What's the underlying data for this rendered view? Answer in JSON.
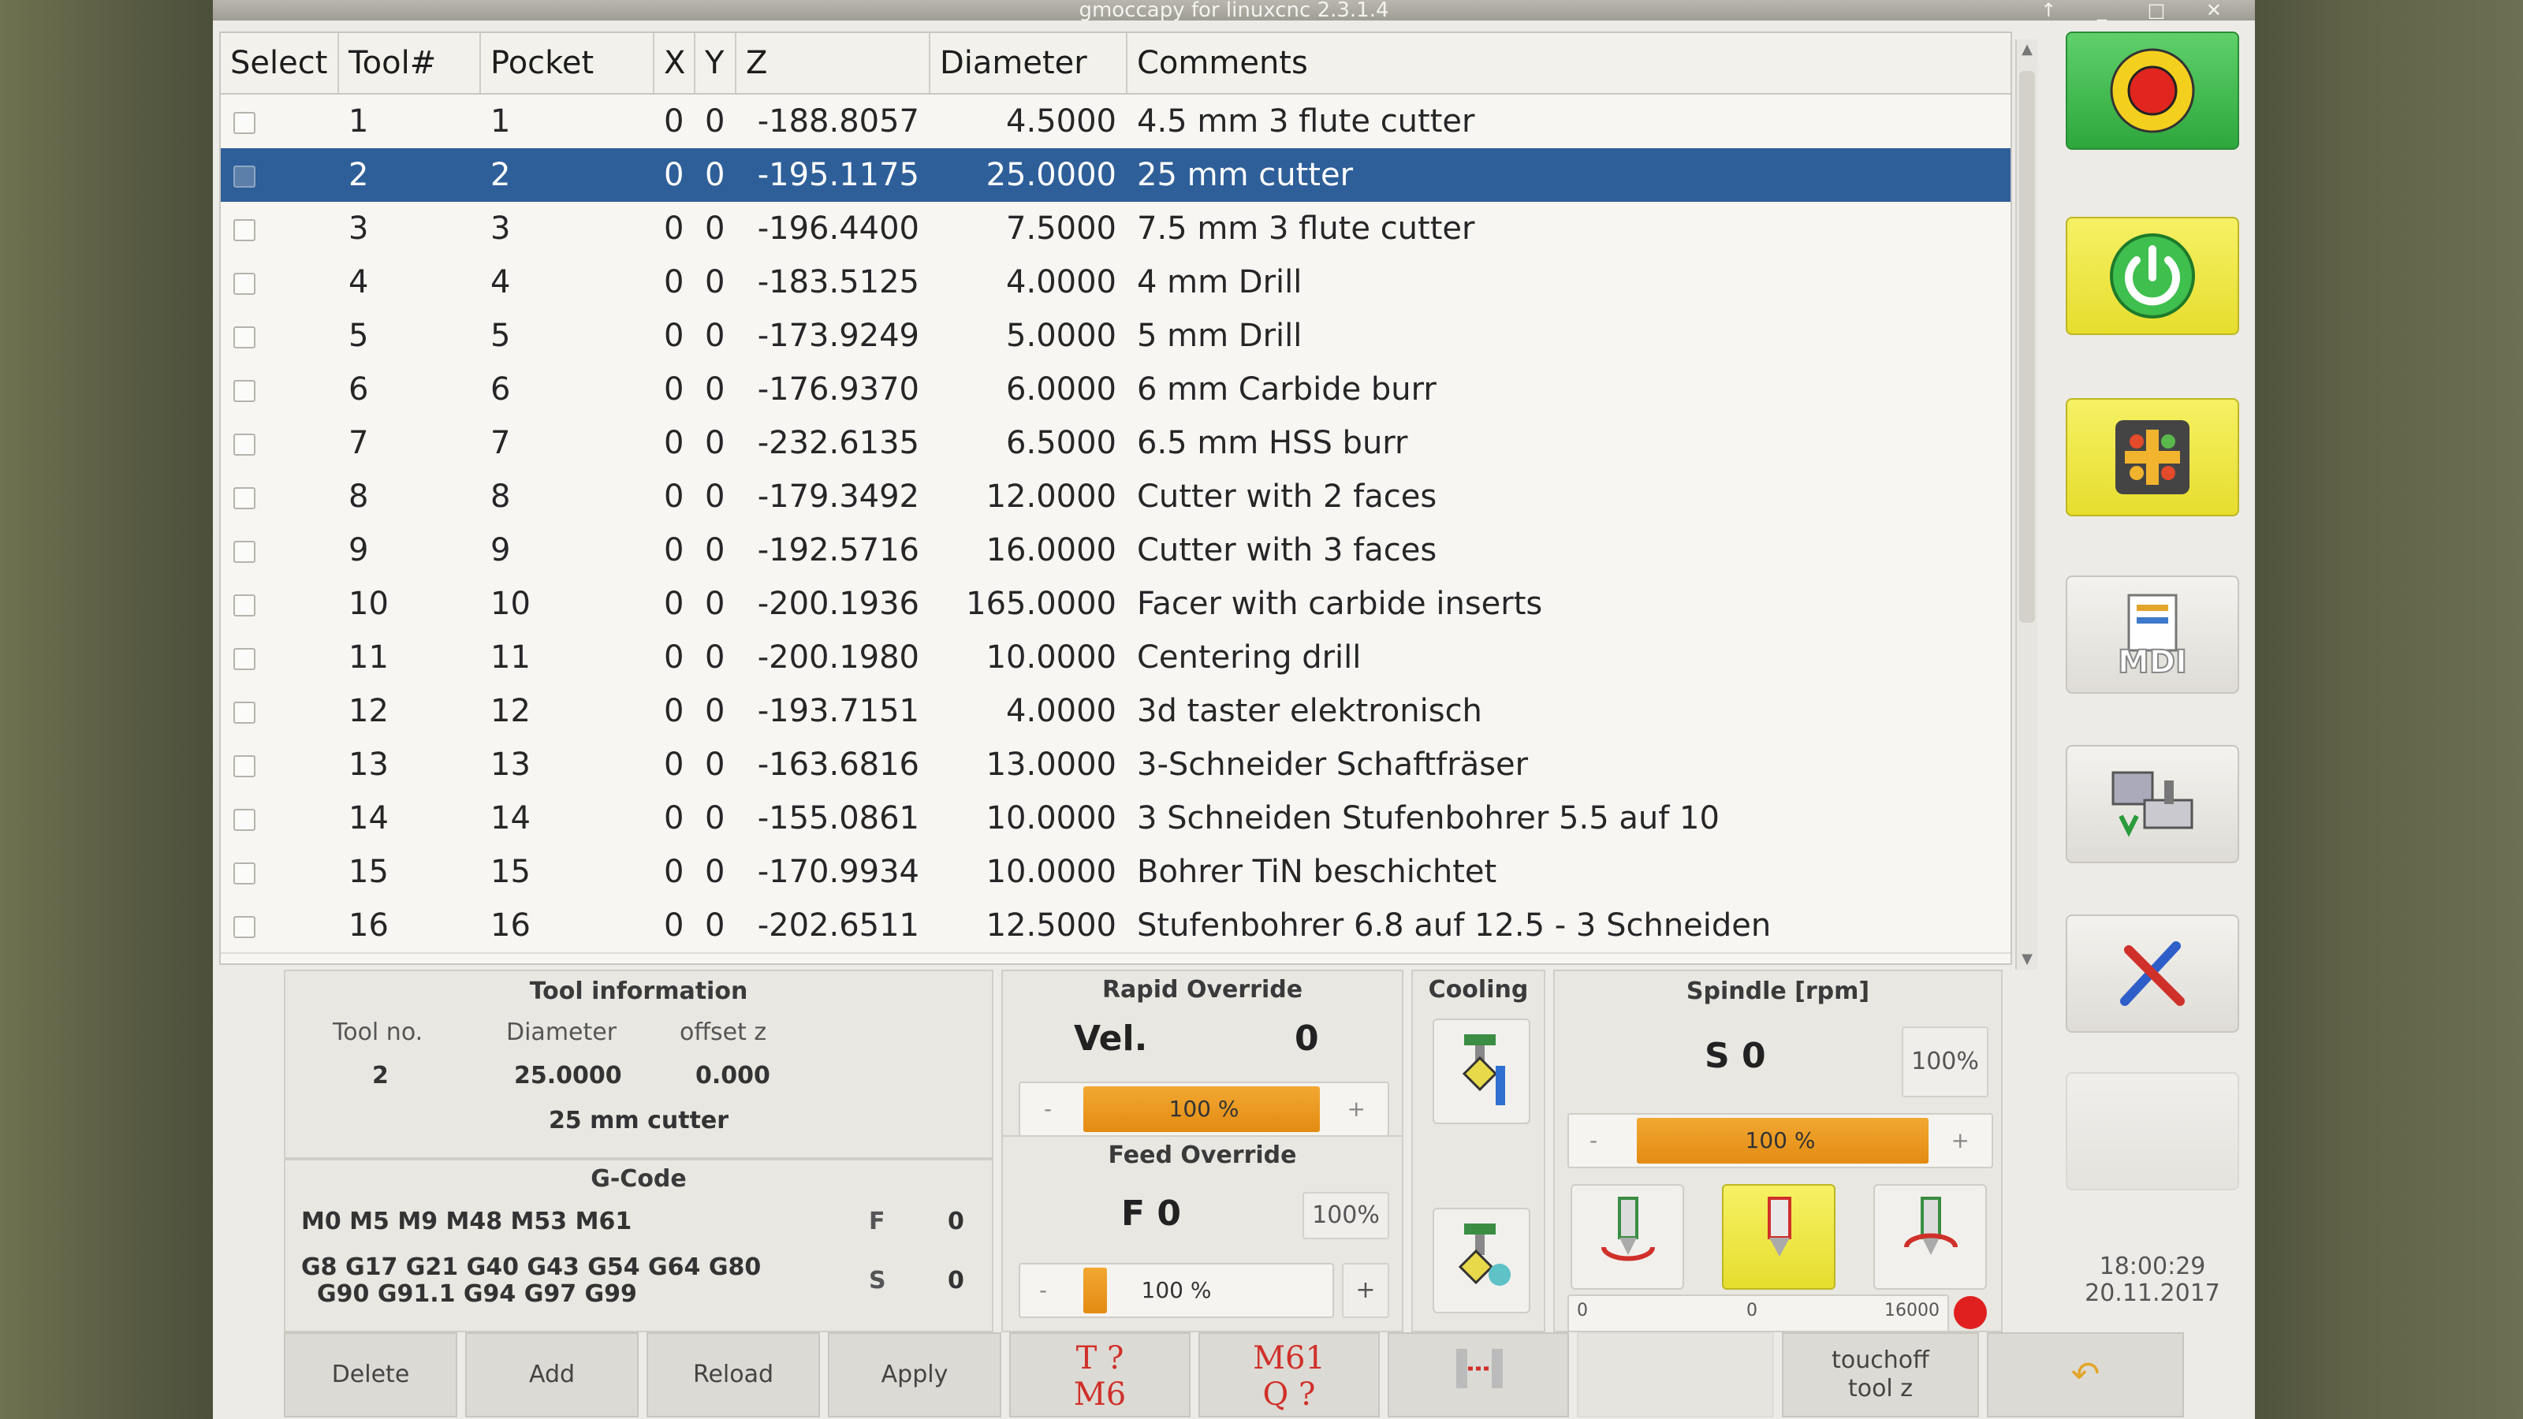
{
  "window": {
    "title": "gmoccapy for linuxcnc  2.3.1.4",
    "controls": "↑ _ □ ✕"
  },
  "table": {
    "headers": [
      "Select",
      "Tool#",
      "Pocket",
      "X",
      "Y",
      "Z",
      "Diameter",
      "Comments"
    ],
    "rows": [
      {
        "tool": "1",
        "pocket": "1",
        "x": "0",
        "y": "0",
        "z": "-188.8057",
        "diameter": "4.5000",
        "comment": "4.5 mm 3 flute cutter"
      },
      {
        "tool": "2",
        "pocket": "2",
        "x": "0",
        "y": "0",
        "z": "-195.1175",
        "diameter": "25.0000",
        "comment": "25 mm cutter",
        "selected": true
      },
      {
        "tool": "3",
        "pocket": "3",
        "x": "0",
        "y": "0",
        "z": "-196.4400",
        "diameter": "7.5000",
        "comment": "7.5 mm 3 flute cutter"
      },
      {
        "tool": "4",
        "pocket": "4",
        "x": "0",
        "y": "0",
        "z": "-183.5125",
        "diameter": "4.0000",
        "comment": "4 mm Drill"
      },
      {
        "tool": "5",
        "pocket": "5",
        "x": "0",
        "y": "0",
        "z": "-173.9249",
        "diameter": "5.0000",
        "comment": "5 mm Drill"
      },
      {
        "tool": "6",
        "pocket": "6",
        "x": "0",
        "y": "0",
        "z": "-176.9370",
        "diameter": "6.0000",
        "comment": "6 mm Carbide burr"
      },
      {
        "tool": "7",
        "pocket": "7",
        "x": "0",
        "y": "0",
        "z": "-232.6135",
        "diameter": "6.5000",
        "comment": "6.5 mm HSS burr"
      },
      {
        "tool": "8",
        "pocket": "8",
        "x": "0",
        "y": "0",
        "z": "-179.3492",
        "diameter": "12.0000",
        "comment": "Cutter with 2 faces"
      },
      {
        "tool": "9",
        "pocket": "9",
        "x": "0",
        "y": "0",
        "z": "-192.5716",
        "diameter": "16.0000",
        "comment": "Cutter with 3 faces"
      },
      {
        "tool": "10",
        "pocket": "10",
        "x": "0",
        "y": "0",
        "z": "-200.1936",
        "diameter": "165.0000",
        "comment": "Facer with carbide inserts"
      },
      {
        "tool": "11",
        "pocket": "11",
        "x": "0",
        "y": "0",
        "z": "-200.1980",
        "diameter": "10.0000",
        "comment": "Centering drill"
      },
      {
        "tool": "12",
        "pocket": "12",
        "x": "0",
        "y": "0",
        "z": "-193.7151",
        "diameter": "4.0000",
        "comment": "3d taster elektronisch"
      },
      {
        "tool": "13",
        "pocket": "13",
        "x": "0",
        "y": "0",
        "z": "-163.6816",
        "diameter": "13.0000",
        "comment": "3-Schneider Schaftfräser"
      },
      {
        "tool": "14",
        "pocket": "14",
        "x": "0",
        "y": "0",
        "z": "-155.0861",
        "diameter": "10.0000",
        "comment": "3 Schneiden Stufenbohrer 5.5 auf 10"
      },
      {
        "tool": "15",
        "pocket": "15",
        "x": "0",
        "y": "0",
        "z": "-170.9934",
        "diameter": "10.0000",
        "comment": "Bohrer TiN beschichtet"
      },
      {
        "tool": "16",
        "pocket": "16",
        "x": "0",
        "y": "0",
        "z": "-202.6511",
        "diameter": "12.5000",
        "comment": "Stufenbohrer 6.8 auf 12.5 - 3 Schneiden"
      }
    ]
  },
  "tool_info": {
    "title": "Tool information",
    "tool_no_label": "Tool no.",
    "diameter_label": "Diameter",
    "offset_label": "offset z",
    "tool_no": "2",
    "diameter": "25.0000",
    "offset": "0.000",
    "comment": "25 mm cutter"
  },
  "gcode": {
    "title": "G-Code",
    "mcodes": "M0 M5 M9 M48 M53 M61",
    "gcodes_line1": "G8 G17 G21 G40 G43 G54 G64 G80",
    "gcodes_line2": "G90 G91.1 G94 G97 G99",
    "f_label": "F",
    "f_value": "0",
    "s_label": "S",
    "s_value": "0"
  },
  "rapid": {
    "title": "Rapid Override",
    "vel_label": "Vel.",
    "vel_value": "0",
    "slider_text": "100 %",
    "level": 1.0,
    "minus": "-",
    "plus": "+"
  },
  "feed": {
    "title": "Feed Override",
    "f_text": "F  0",
    "pct": "100%",
    "slider_text": "100 %",
    "level": 0.1,
    "minus": "-",
    "plus": "+"
  },
  "cooling": {
    "title": "Cooling"
  },
  "spindle": {
    "title": "Spindle [rpm]",
    "s_text": "S 0",
    "pct": "100%",
    "slider_text": "100 %",
    "minus": "-",
    "plus": "+",
    "bar_min": "0",
    "bar_cur": "0",
    "bar_max": "16000"
  },
  "sidebar": {
    "time": "18:00:29",
    "date": "20.11.2017"
  },
  "buttons": {
    "delete": "Delete",
    "add": "Add",
    "reload": "Reload",
    "apply": "Apply",
    "t_line1": "T ?",
    "t_line2": "M6",
    "m61_line1": "M61",
    "m61_line2": "Q ?",
    "touchoff_line1": "touchoff",
    "touchoff_line2": "tool z"
  },
  "colors": {
    "selected_row": "#2e5f99",
    "accent_orange": "#e38b12",
    "estop_green": "#2ea73d",
    "power_yellow": "#e6dd2e"
  }
}
